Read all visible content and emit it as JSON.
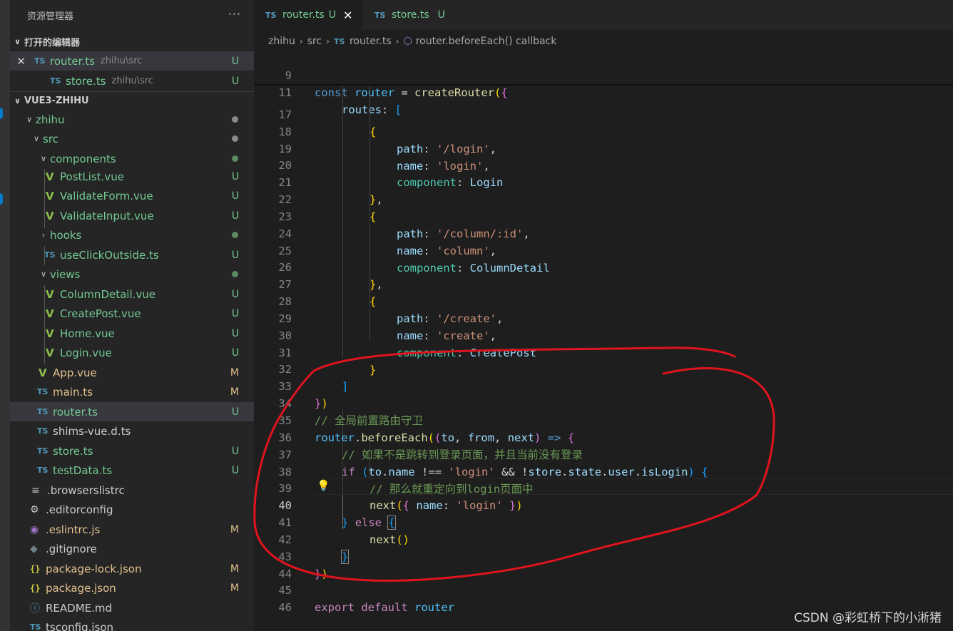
{
  "sidebar": {
    "title": "资源管理器",
    "more": "···",
    "open_editors": {
      "header": "打开的编辑器",
      "items": [
        {
          "icon": "TS",
          "name": "router.ts",
          "path": "zhihu\\src",
          "badge": "U"
        },
        {
          "icon": "TS",
          "name": "store.ts",
          "path": "zhihu\\src",
          "badge": "U"
        }
      ]
    },
    "project": {
      "header": "VUE3-ZHIHU",
      "tree": [
        {
          "name": "zhihu"
        },
        {
          "name": "src"
        },
        {
          "name": "components"
        },
        {
          "name": "PostList.vue",
          "badge": "U"
        },
        {
          "name": "ValidateForm.vue",
          "badge": "U"
        },
        {
          "name": "ValidateInput.vue",
          "badge": "U"
        },
        {
          "name": "hooks"
        },
        {
          "name": "useClickOutside.ts",
          "icon": "TS",
          "badge": "U"
        },
        {
          "name": "views"
        },
        {
          "name": "ColumnDetail.vue",
          "badge": "U"
        },
        {
          "name": "CreatePost.vue",
          "badge": "U"
        },
        {
          "name": "Home.vue",
          "badge": "U"
        },
        {
          "name": "Login.vue",
          "badge": "U"
        },
        {
          "name": "App.vue",
          "badge": "M"
        },
        {
          "name": "main.ts",
          "icon": "TS",
          "badge": "M"
        },
        {
          "name": "router.ts",
          "icon": "TS",
          "badge": "U"
        },
        {
          "name": "shims-vue.d.ts",
          "icon": "TS"
        },
        {
          "name": "store.ts",
          "icon": "TS",
          "badge": "U"
        },
        {
          "name": "testData.ts",
          "icon": "TS",
          "badge": "U"
        },
        {
          "name": ".browserslistrc"
        },
        {
          "name": ".editorconfig"
        },
        {
          "name": ".eslintrc.js",
          "badge": "M"
        },
        {
          "name": ".gitignore"
        },
        {
          "name": "package-lock.json",
          "icon": "{}",
          "badge": "M"
        },
        {
          "name": "package.json",
          "icon": "{}",
          "badge": "M"
        },
        {
          "name": "README.md"
        },
        {
          "name": "tsconfig.json",
          "icon": "TS"
        }
      ]
    }
  },
  "tabs": [
    {
      "icon": "TS",
      "label": "router.ts",
      "status": "U",
      "close": "✕"
    },
    {
      "icon": "TS",
      "label": "store.ts",
      "status": "U"
    }
  ],
  "breadcrumb": {
    "items": [
      "zhihu",
      "src",
      "router.ts",
      "router.beforeEach() callback"
    ],
    "ts_icon": "TS",
    "separator": "›"
  },
  "editor": {
    "line_numbers": [
      "9",
      "11",
      "17",
      "18",
      "19",
      "20",
      "21",
      "22",
      "23",
      "24",
      "25",
      "26",
      "27",
      "28",
      "29",
      "30",
      "31",
      "32",
      "33",
      "34",
      "35",
      "36",
      "37",
      "38",
      "39",
      "40",
      "41",
      "42",
      "43",
      "44",
      "45",
      "46"
    ],
    "current_line": "40",
    "code": {
      "l9": [
        "const",
        " ",
        "router",
        " = ",
        "createRouter",
        "(",
        "{"
      ],
      "l11": [
        "routes",
        ": ",
        "["
      ],
      "l17": [
        "{"
      ],
      "l18": [
        "path",
        ": ",
        "'/login'",
        ","
      ],
      "l19": [
        "name",
        ": ",
        "'login'",
        ","
      ],
      "l20": [
        "component",
        ": ",
        "Login"
      ],
      "l21": [
        "}",
        ","
      ],
      "l22": [
        "{"
      ],
      "l23": [
        "path",
        ": ",
        "'/column/:id'",
        ","
      ],
      "l24": [
        "name",
        ": ",
        "'column'",
        ","
      ],
      "l25": [
        "component",
        ": ",
        "ColumnDetail"
      ],
      "l26": [
        "}",
        ","
      ],
      "l27": [
        "{"
      ],
      "l28": [
        "path",
        ": ",
        "'/create'",
        ","
      ],
      "l29": [
        "name",
        ": ",
        "'create'",
        ","
      ],
      "l30": [
        "component",
        ": ",
        "CreatePost"
      ],
      "l31": [
        "}"
      ],
      "l32": [
        "]"
      ],
      "l33": [
        "}",
        ")"
      ],
      "l34": [
        "// 全局前置路由守卫"
      ],
      "l35": [
        "router",
        ".",
        "beforeEach",
        "(",
        "(",
        "to",
        ", ",
        "from",
        ", ",
        "next",
        ")",
        " ",
        "=>",
        " ",
        "{"
      ],
      "l36": [
        "// 如果不是跳转到登录页面，并且当前没有登录"
      ],
      "l37": [
        "if",
        " ",
        "(",
        "to",
        ".",
        "name",
        " !== ",
        "'login'",
        " && !",
        "store",
        ".",
        "state",
        ".",
        "user",
        ".",
        "isLogin",
        ")",
        " ",
        "{"
      ],
      "l38": [
        "// 那么就重定向到login页面中"
      ],
      "l39": [
        "next",
        "(",
        "{",
        " ",
        "name",
        ": ",
        "'login'",
        " ",
        "}",
        ")"
      ],
      "l40": [
        "}",
        " ",
        "else",
        " ",
        "{"
      ],
      "l41": [
        "next",
        "(",
        ")"
      ],
      "l42": [
        "}"
      ],
      "l43": [
        "}",
        ")"
      ],
      "l45": [
        "export",
        " ",
        "default",
        " ",
        "router"
      ]
    }
  },
  "watermark": "CSDN @彩虹桥下的小淅猪",
  "colors": {
    "accent": "#007acc",
    "untracked": "#73c991",
    "modified": "#e2c08d",
    "annotation": "#e0141e"
  }
}
